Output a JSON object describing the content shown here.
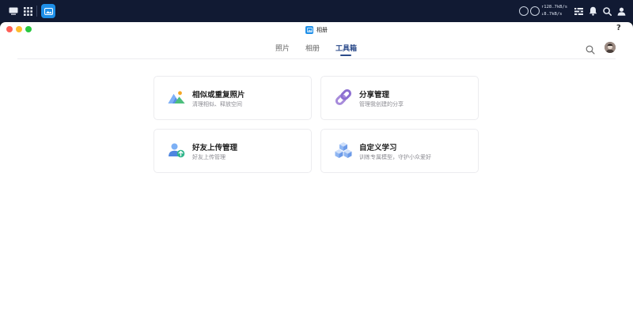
{
  "system_bar": {
    "upload_rate": "↑128.7kB/s",
    "download_rate": "↓8.7kB/s"
  },
  "window": {
    "title": "相册",
    "help_label": "?"
  },
  "tabs": [
    {
      "label": "照片",
      "active": false
    },
    {
      "label": "相册",
      "active": false
    },
    {
      "label": "工具箱",
      "active": true
    }
  ],
  "cards": [
    {
      "title": "相似或重复照片",
      "subtitle": "清理相似、释放空间",
      "icon": "mountain-photo-icon"
    },
    {
      "title": "分享管理",
      "subtitle": "管理我创建的分享",
      "icon": "link-icon"
    },
    {
      "title": "好友上传管理",
      "subtitle": "好友上传管理",
      "icon": "user-upload-icon"
    },
    {
      "title": "自定义学习",
      "subtitle": "训练专属模型，守护小众爱好",
      "icon": "cubes-icon"
    }
  ],
  "colors": {
    "accent": "#2b4a8a",
    "system_bar": "#111a33",
    "app_icon": "#1e8fe8"
  }
}
